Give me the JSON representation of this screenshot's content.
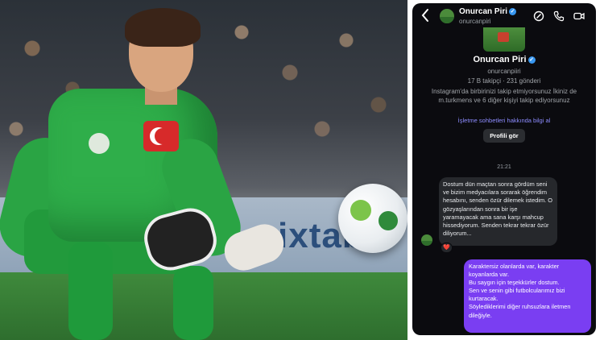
{
  "photo": {
    "board_text": "ixtab"
  },
  "header": {
    "name": "Onurcan Piri",
    "username": "onurcanpiri",
    "icons": [
      "back-chevron-icon",
      "verified-badge-icon",
      "link-icon",
      "phone-icon",
      "video-camera-icon"
    ]
  },
  "profile": {
    "name": "Onurcan Piri",
    "username": "onurcanpiiri",
    "stats": "17 B takipçi · 231 gönderi",
    "follow_info": "Instagram'da birbirinizi takip etmiyorsunuz İkiniz de m.turkmens ve 6 diğer kişiyi takip ediyorsunuz",
    "info_link": "İşletme sohbetleri hakkında bilgi al",
    "view_profile_button": "Profili gör"
  },
  "conversation": {
    "timestamp": "21:21",
    "incoming": {
      "text": "Dostum dün maçtan sonra gördüm seni ve bizim medyacılara sorarak öğrendim hesabını, senden özür dilemek istedim. O gözyaşlarından sonra bir işe yaramayacak ama sana karşı mahcup hissediyorum. Senden tekrar tekrar özür diliyorum...",
      "reaction": "❤️"
    },
    "outgoing": {
      "lines": [
        "Karaktersiz olanlarda var, karakter koyanlarda var.",
        "Bu saygın için teşekkürler dostum.",
        "Sen ve senin gibi futbolcularımız bizi kurtaracak.",
        "Söylediklerimi diğer ruhsuzlara iletmen dileğiyle."
      ]
    }
  },
  "colors": {
    "chat_bg": "#0b0b0f",
    "incoming_bubble": "#26282c",
    "outgoing_bubble": "#7a3ef2",
    "verified_blue": "#3897f0",
    "link_purple": "#8d8cff"
  }
}
